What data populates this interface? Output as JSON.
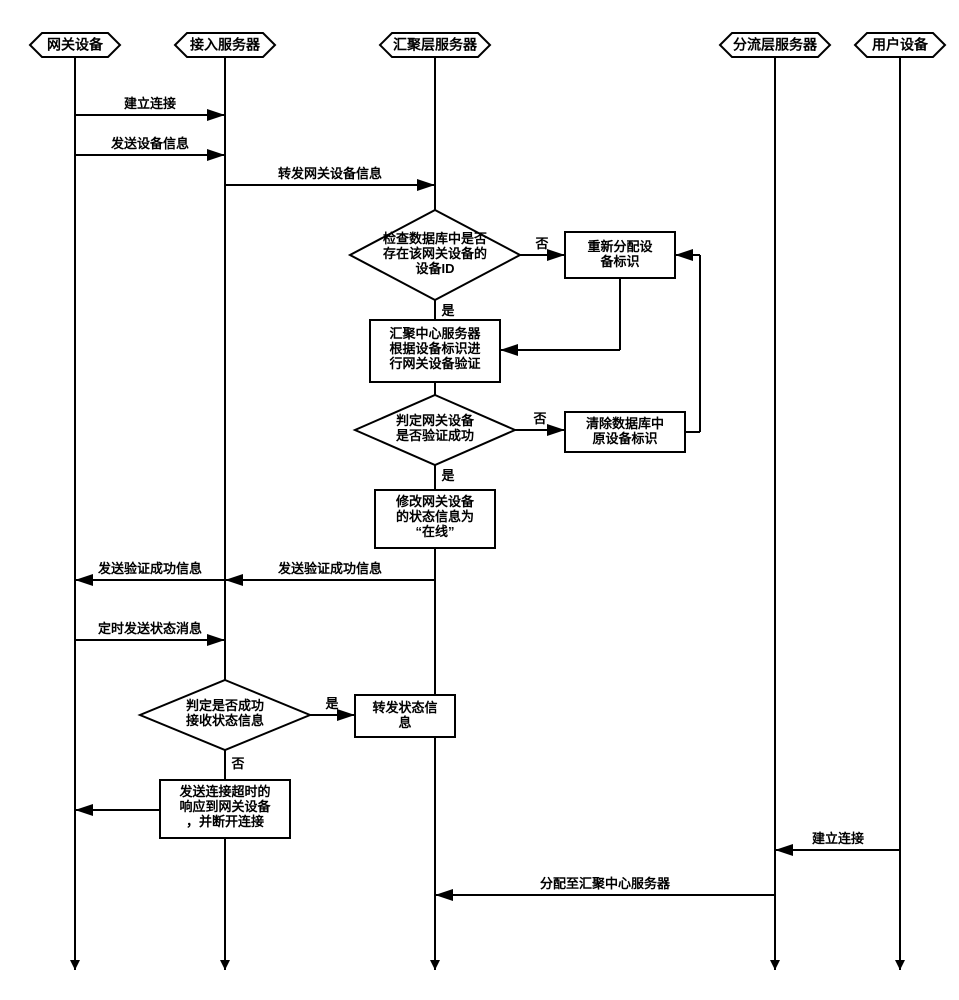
{
  "lanes": {
    "gateway": "网关设备",
    "access": "接入服务器",
    "agg": "汇聚层服务器",
    "dist": "分流层服务器",
    "user": "用户设备"
  },
  "messages": {
    "m1": "建立连接",
    "m2": "发送设备信息",
    "m3": "转发网关设备信息",
    "m4a": "发送验证成功信息",
    "m4b": "发送验证成功信息",
    "m5": "定时发送状态消息",
    "m6": "建立连接",
    "m7": "分配至汇聚中心服务器"
  },
  "decisions": {
    "d1": "检查数据库中是否\n存在该网关设备的\n设备ID",
    "d2": "判定网关设备\n是否验证成功",
    "d3": "判定是否成功\n接收状态信息"
  },
  "processes": {
    "p1": "重新分配设\n备标识",
    "p2": "汇聚中心服务器\n根据设备标识进\n行网关设备验证",
    "p3": "清除数据库中\n原设备标识",
    "p4": "修改网关设备\n的状态信息为\n“在线”",
    "p5": "转发状态信\n息",
    "p6": "发送连接超时的\n响应到网关设备\n，并断开连接"
  },
  "edgeLabels": {
    "yes": "是",
    "no": "否"
  }
}
